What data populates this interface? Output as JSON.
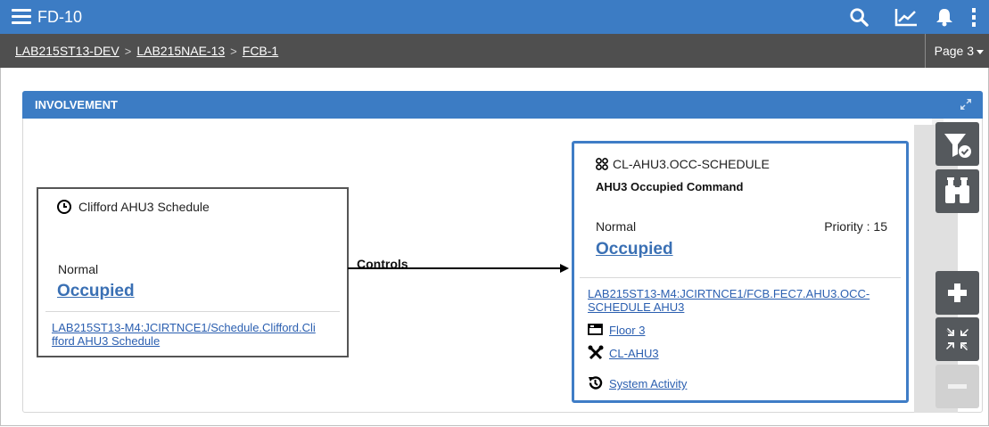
{
  "app": {
    "title": "FD-10"
  },
  "breadcrumb": [
    "LAB215ST13-DEV",
    "LAB215NAE-13",
    "FCB-1"
  ],
  "page_selector": {
    "label": "Page 3"
  },
  "panel": {
    "title": "INVOLVEMENT"
  },
  "source": {
    "name": "Clifford AHU3 Schedule",
    "status": "Normal",
    "value": "Occupied",
    "reference": "LAB215ST13-M4:JCIRTNCE1/Schedule.Clifford.Clifford AHU3 Schedule",
    "reference_lines": [
      "LAB215ST13-M4:JCIRTNCE1/Schedule.Clifford.Cli",
      "fford AHU3 Schedule"
    ]
  },
  "relationship": {
    "label": "Controls"
  },
  "target": {
    "name": "CL-AHU3.OCC-SCHEDULE",
    "description": "AHU3 Occupied Command",
    "status": "Normal",
    "priority": "Priority : 15",
    "value": "Occupied",
    "reference_lines": [
      "LAB215ST13-M4:JCIRTNCE1/FCB.FEC7.AHU3.OCC-",
      "SCHEDULE AHU3"
    ],
    "links": {
      "floor": "Floor 3",
      "equipment": "CL-AHU3",
      "activity": "System Activity"
    }
  },
  "colors": {
    "header_blue": "#3c7cc4",
    "breadcrumb_bar": "#4f4f4f",
    "link_blue": "#3a70b4",
    "tool_dark": "#55595d"
  },
  "icons": {
    "topbar": [
      "menu-icon",
      "search-icon",
      "trend-chart-icon",
      "bell-icon",
      "more-vertical-icon"
    ],
    "tools": [
      "filter-check-icon",
      "binoculars-icon",
      "plus-icon",
      "collapse-icon",
      "minus-icon"
    ]
  }
}
